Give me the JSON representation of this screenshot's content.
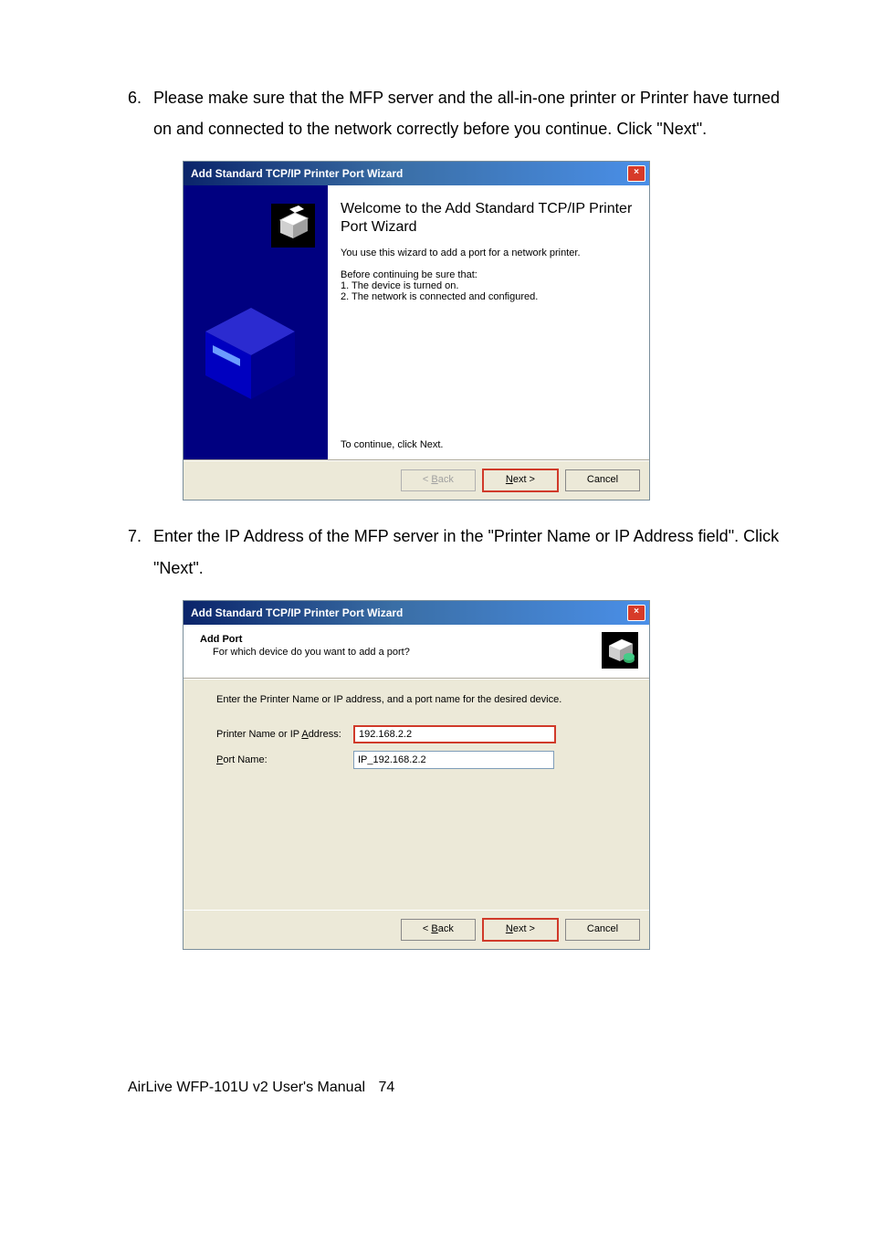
{
  "step6": {
    "num": "6.",
    "text": "Please make sure that the MFP server and the all-in-one printer or Printer have turned on and connected to the network correctly before you continue. Click \"Next\"."
  },
  "step7": {
    "num": "7.",
    "text": "Enter the IP Address of the MFP server in the \"Printer Name or IP Address field\". Click \"Next\"."
  },
  "wiz1": {
    "title": "Add Standard TCP/IP Printer Port Wizard",
    "heading": "Welcome to the Add Standard TCP/IP Printer Port Wizard",
    "desc": "You use this wizard to add a port for a network printer.",
    "before_label": "Before continuing be sure that:",
    "item1": "1.  The device is turned on.",
    "item2": "2.  The network is connected and configured.",
    "continue": "To continue, click Next.",
    "back": "< Back",
    "next": "Next >",
    "cancel": "Cancel"
  },
  "wiz2": {
    "title": "Add Standard TCP/IP Printer Port Wizard",
    "head_h": "Add Port",
    "head_s": "For which device do you want to add a port?",
    "intro": "Enter the Printer Name or IP address, and a port name for the desired device.",
    "label_addr": "Printer Name or IP Address:",
    "label_port": "Port Name:",
    "val_addr": "192.168.2.2",
    "val_port": "IP_192.168.2.2",
    "back": "< Back",
    "next": "Next >",
    "cancel": "Cancel"
  },
  "footer": {
    "manual": "AirLive WFP-101U v2 User's Manual",
    "page": "74"
  }
}
